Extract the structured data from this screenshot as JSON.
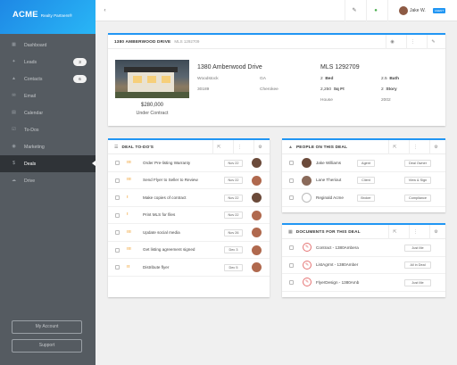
{
  "brand": {
    "name": "ACME",
    "sub": "Realty Partners®"
  },
  "nav": [
    {
      "label": "Dashboard",
      "icon": "dashboard-icon",
      "glyph": "▦"
    },
    {
      "label": "Leads",
      "icon": "leads-icon",
      "glyph": "✦",
      "count": "3"
    },
    {
      "label": "Contacts",
      "icon": "contacts-icon",
      "glyph": "▲",
      "count": "6"
    },
    {
      "label": "Email",
      "icon": "email-icon",
      "glyph": "✉"
    },
    {
      "label": "Calendar",
      "icon": "calendar-icon",
      "glyph": "▤"
    },
    {
      "label": "To-Dos",
      "icon": "todos-icon",
      "glyph": "☑"
    },
    {
      "label": "Marketing",
      "icon": "marketing-icon",
      "glyph": "◉"
    },
    {
      "label": "Deals",
      "icon": "deals-icon",
      "glyph": "$",
      "active": true
    },
    {
      "label": "Drive",
      "icon": "drive-icon",
      "glyph": "☁"
    }
  ],
  "sidebar_buttons": {
    "account": "My Account",
    "support": "Support"
  },
  "topbar": {
    "user": "Jake W.",
    "badge": "AGENT"
  },
  "property": {
    "header_title": "1380 AMBERWOOD DRIVE",
    "header_mls": "MLS 1292709",
    "address": "1380 Amberwood Drive",
    "city": "Woodstock",
    "state": "GA",
    "zip": "30189",
    "county": "Cherokee",
    "price": "$280,000",
    "status": "Under Contract",
    "mls": "MLS 1292709",
    "beds_n": "2",
    "beds_l": "Bed",
    "baths_n": "2.5",
    "baths_l": "Bath",
    "sqft_n": "2,250",
    "sqft_l": "Sq Ft",
    "stories_n": "2",
    "stories_l": "Story",
    "type": "House",
    "year": "2002"
  },
  "todos": {
    "title": "DEAL TO-DO'S",
    "items": [
      {
        "text": "Order Pre-listing Warranty",
        "date": "Nov 22",
        "pr": "!!!",
        "prcolor": "#f0a030",
        "av": "#6b4a3a"
      },
      {
        "text": "Send Flyer to Seller to Review",
        "date": "Nov 22",
        "pr": "!!!",
        "prcolor": "#f0a030",
        "av": "#b0694e"
      },
      {
        "text": "Make copies of contract",
        "date": "Nov 22",
        "pr": "!",
        "prcolor": "#f0a030",
        "av": "#6b4a3a"
      },
      {
        "text": "Print MLS for files",
        "date": "Nov 22",
        "pr": "!",
        "prcolor": "#f0a030",
        "av": "#b0694e"
      },
      {
        "text": "Update social media",
        "date": "Nov 26",
        "pr": "!!!",
        "prcolor": "#f0a030",
        "av": "#b0694e"
      },
      {
        "text": "Get listing agreement signed",
        "date": "Dec 3",
        "pr": "!!!",
        "prcolor": "#f0a030",
        "av": "#b0694e"
      },
      {
        "text": "Distribute flyer",
        "date": "Dec 5",
        "pr": "!!",
        "prcolor": "#f0a030",
        "av": "#b0694e"
      }
    ]
  },
  "people": {
    "title": "PEOPLE ON THIS DEAL",
    "items": [
      {
        "name": "Jake Williams",
        "role": "Agent",
        "tag": "Deal Owner",
        "av": "#6b4a3a"
      },
      {
        "name": "Lane Theriout",
        "role": "Client",
        "tag": "View & Sign",
        "av": "#8a6a5a"
      },
      {
        "name": "Reginald Acme",
        "role": "Broker",
        "tag": "Compliance",
        "av": ""
      }
    ]
  },
  "documents": {
    "title": "DOCUMENTS FOR THIS DEAL",
    "items": [
      {
        "name": "Contract - 1380Ambera",
        "tag": "Just Me"
      },
      {
        "name": "ListAgrmt - 1380Amber",
        "tag": "All in Deal"
      },
      {
        "name": "FlyerDesign - 1380Amb",
        "tag": "Just Me"
      }
    ]
  }
}
